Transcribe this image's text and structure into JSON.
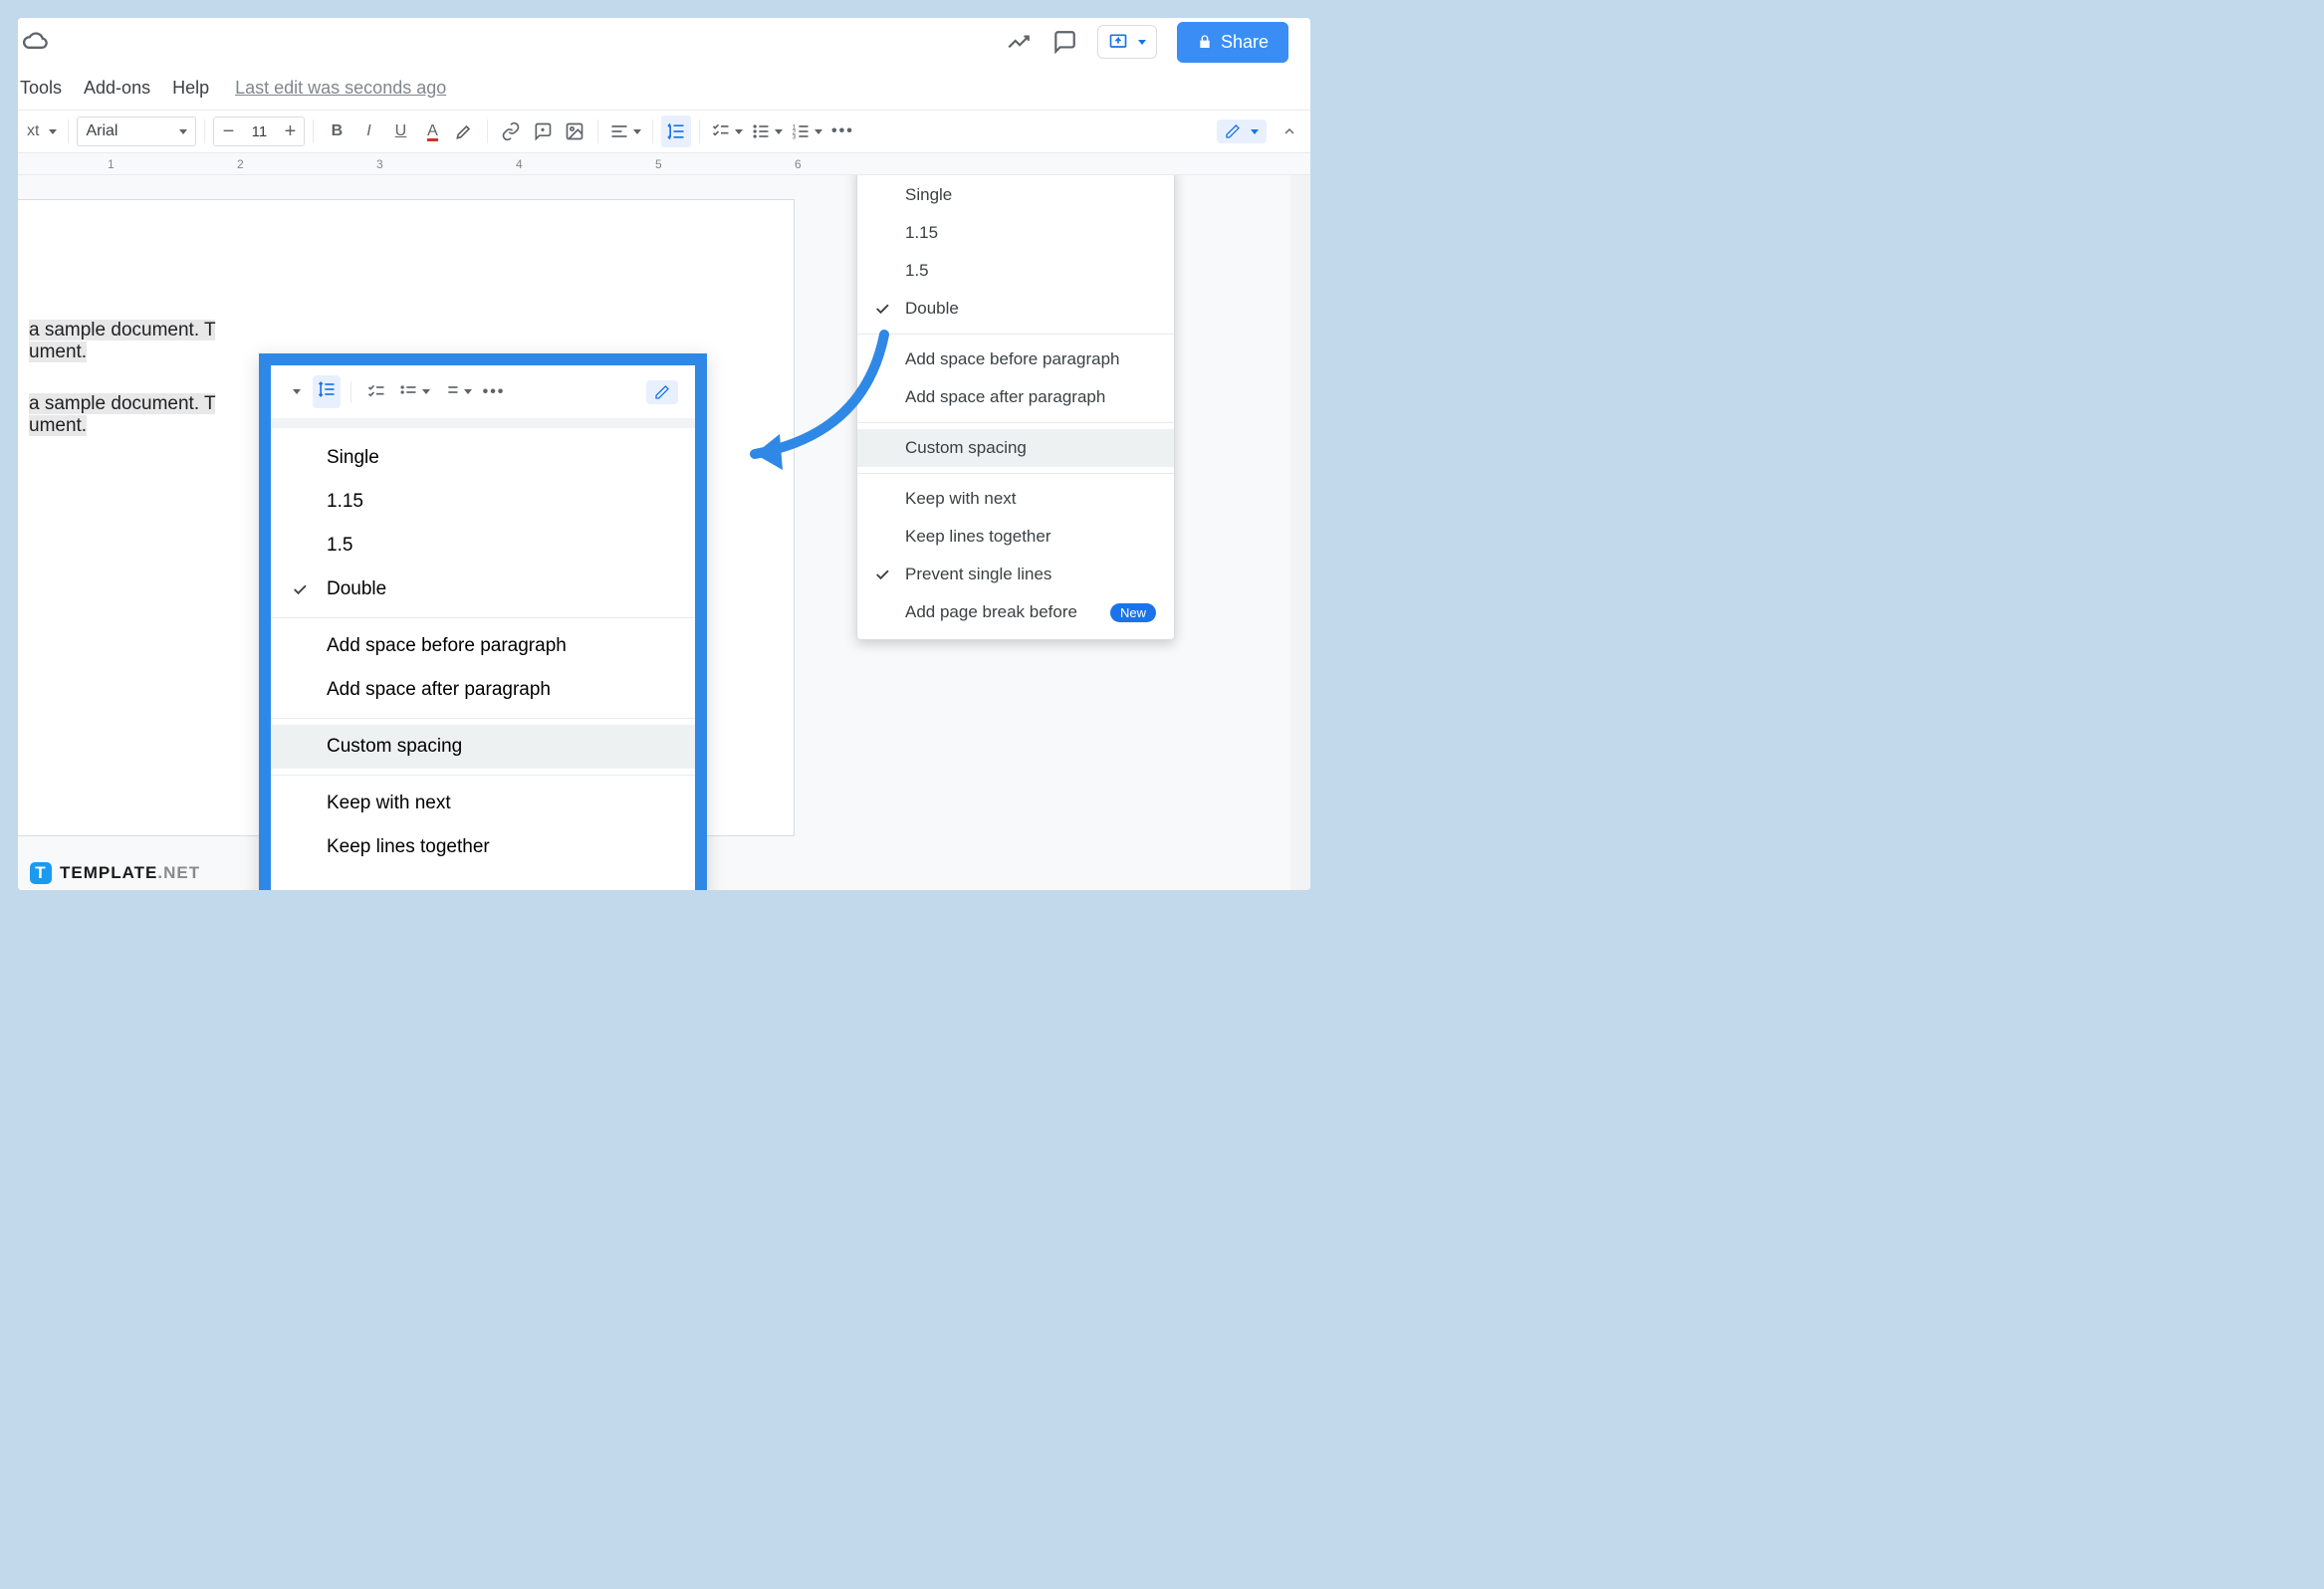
{
  "header": {
    "menus": [
      "Tools",
      "Add-ons",
      "Help"
    ],
    "last_edit": "Last edit was seconds ago",
    "share_label": "Share"
  },
  "toolbar": {
    "style_label": "xt",
    "font_name": "Arial",
    "font_size": "11"
  },
  "ruler": {
    "ticks": [
      "1",
      "2",
      "3",
      "4",
      "5",
      "6"
    ]
  },
  "document": {
    "line1_a": " a sample document. T",
    "line1_b": "ument.",
    "line2_a": " a sample document. T",
    "line2_b": "ument."
  },
  "linespacing_menu": {
    "items_section1": [
      {
        "label": "Single",
        "checked": false
      },
      {
        "label": "1.15",
        "checked": false
      },
      {
        "label": "1.5",
        "checked": false
      },
      {
        "label": "Double",
        "checked": true
      }
    ],
    "items_section2": [
      {
        "label": "Add space before paragraph"
      },
      {
        "label": "Add space after paragraph"
      }
    ],
    "items_section3": [
      {
        "label": "Custom spacing",
        "hover": true
      }
    ],
    "items_section4": [
      {
        "label": "Keep with next",
        "checked": false
      },
      {
        "label": "Keep lines together",
        "checked": false
      },
      {
        "label": "Prevent single lines",
        "checked": true
      },
      {
        "label": "Add page break before",
        "checked": false,
        "new": true
      }
    ]
  },
  "callout_menu": {
    "items_section1": [
      {
        "label": "Single",
        "checked": false
      },
      {
        "label": "1.15",
        "checked": false
      },
      {
        "label": "1.5",
        "checked": false
      },
      {
        "label": "Double",
        "checked": true
      }
    ],
    "items_section2": [
      {
        "label": "Add space before paragraph"
      },
      {
        "label": "Add space after paragraph"
      }
    ],
    "items_section3": [
      {
        "label": "Custom spacing",
        "hover": true
      }
    ],
    "items_section4": [
      {
        "label": "Keep with next"
      },
      {
        "label": "Keep lines together"
      }
    ]
  },
  "badge_new": "New",
  "watermark": {
    "brand": "TEMPLATE",
    "suffix": ".NET"
  },
  "colors": {
    "accent": "#1a73e8",
    "annotation": "#2f88e6",
    "share": "#398df5"
  }
}
